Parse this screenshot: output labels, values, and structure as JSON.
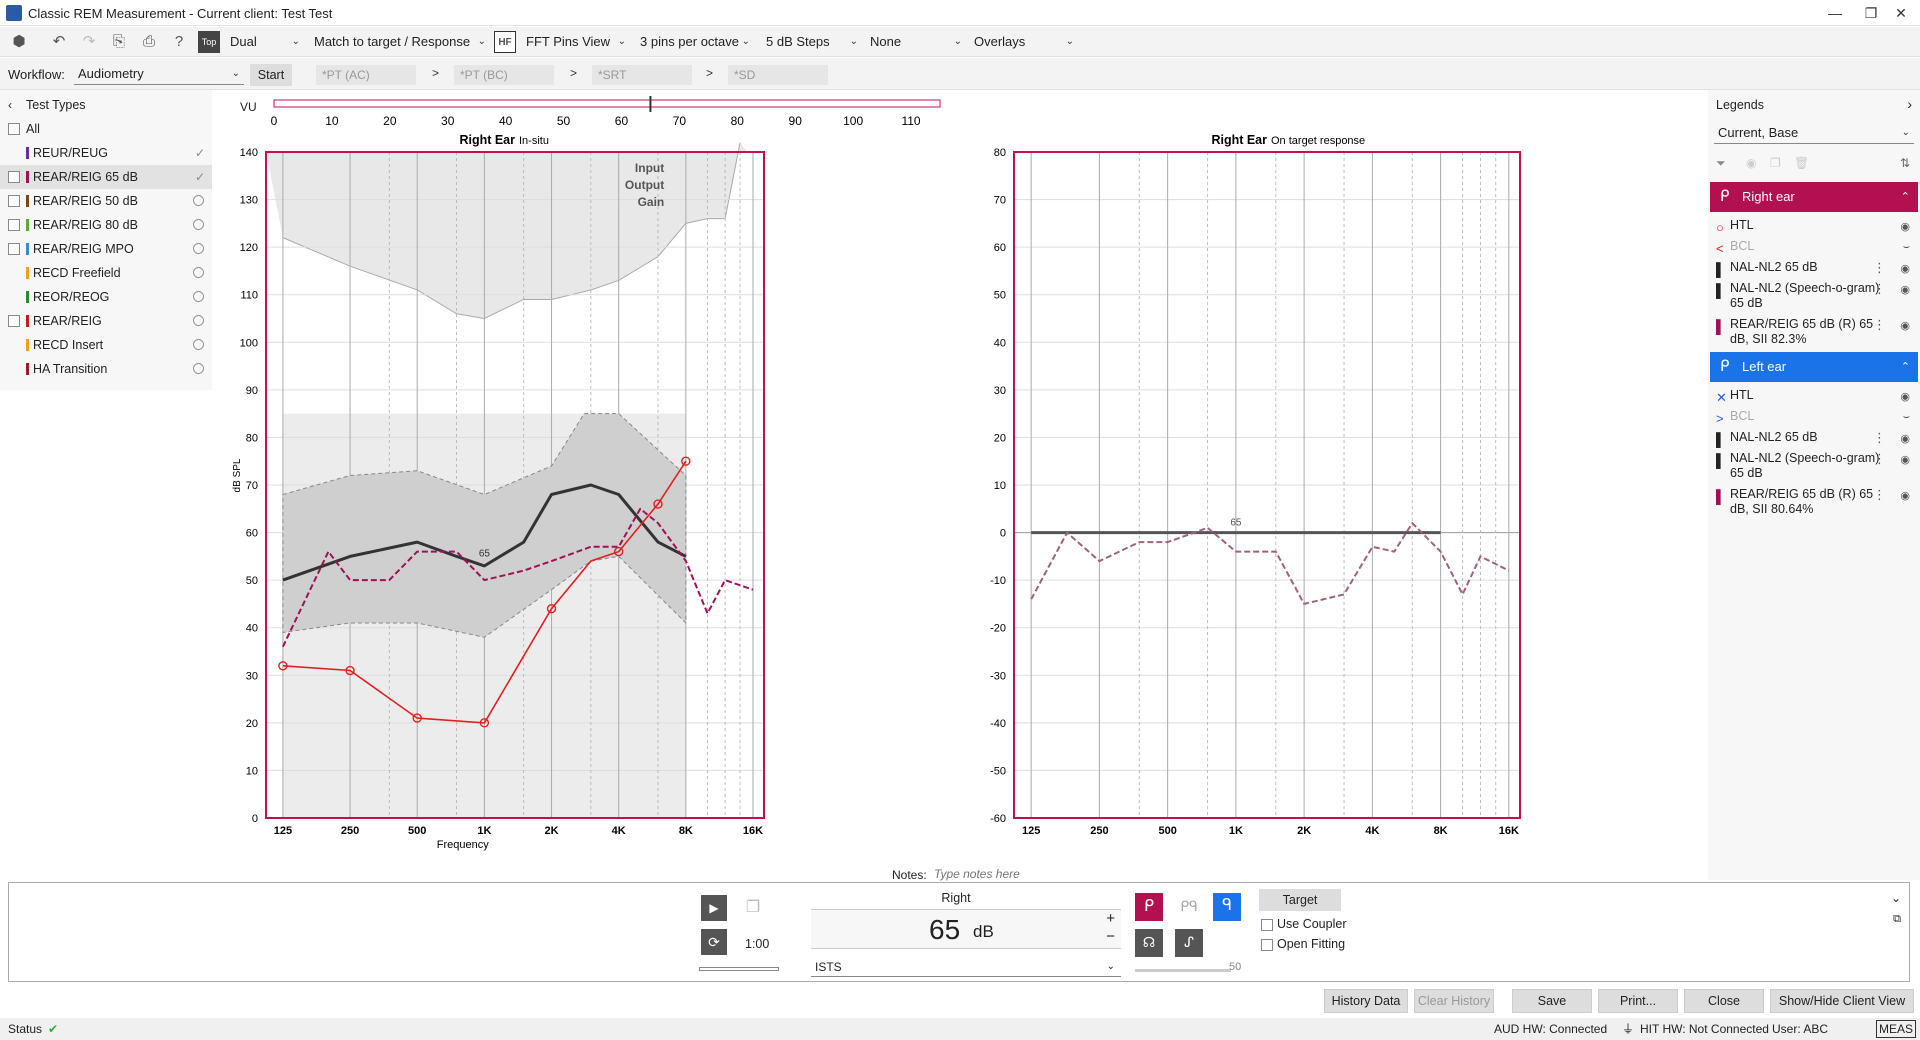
{
  "window": {
    "title": "Classic REM Measurement - Current client: Test Test",
    "min": "—",
    "restore": "❐",
    "close": "✕"
  },
  "toolbar": {
    "dropdowns": [
      "Dual",
      "Match to target / Response",
      "FFT Pins View",
      "3 pins per octave",
      "5 dB Steps",
      "None",
      "Overlays"
    ],
    "hf_label": "HF",
    "top_label": "Top"
  },
  "workflow": {
    "label": "Workflow:",
    "value": "Audiometry",
    "start": "Start",
    "steps": [
      "*PT (AC)",
      "*PT (BC)",
      "*SRT",
      "*SD"
    ]
  },
  "test_types": {
    "header": "Test Types",
    "all_label": "All",
    "items": [
      {
        "label": "REUR/REUG",
        "color": "#6a2aa0",
        "checkbox": false,
        "state": "check",
        "selected": false
      },
      {
        "label": "REAR/REIG 65 dB",
        "color": "#a0105a",
        "checkbox": true,
        "state": "check",
        "selected": true
      },
      {
        "label": "REAR/REIG 50 dB",
        "color": "#7a4a1a",
        "checkbox": true,
        "state": "circle",
        "selected": false
      },
      {
        "label": "REAR/REIG 80 dB",
        "color": "#5aaa30",
        "checkbox": true,
        "state": "circle",
        "selected": false
      },
      {
        "label": "REAR/REIG MPO",
        "color": "#3a8ad8",
        "checkbox": true,
        "state": "circle",
        "selected": false
      },
      {
        "label": "RECD Freefield",
        "color": "#f0a020",
        "checkbox": false,
        "state": "circle",
        "selected": false
      },
      {
        "label": "REOR/REOG",
        "color": "#2a8a3a",
        "checkbox": false,
        "state": "circle",
        "selected": false
      },
      {
        "label": "REAR/REIG",
        "color": "#c01a1a",
        "checkbox": true,
        "state": "circle",
        "selected": false
      },
      {
        "label": "RECD Insert",
        "color": "#f0a020",
        "checkbox": false,
        "state": "circle",
        "selected": false
      },
      {
        "label": "HA Transition",
        "color": "#a01a1a",
        "checkbox": false,
        "state": "circle",
        "selected": false
      }
    ]
  },
  "vu": {
    "label": "VU",
    "ticks": [
      "0",
      "10",
      "20",
      "30",
      "40",
      "50",
      "60",
      "70",
      "80",
      "90",
      "100",
      "110"
    ],
    "level": 65
  },
  "chart_data": [
    {
      "type": "line",
      "title": "Right Ear",
      "subtitle": "In-situ",
      "xlabel": "Frequency",
      "ylabel": "dB SPL",
      "x_ticks": [
        "125",
        "250",
        "500",
        "1K",
        "2K",
        "4K",
        "8K",
        "16K"
      ],
      "ylim": [
        0,
        140
      ],
      "y_ticks": [
        "0",
        "10",
        "20",
        "30",
        "40",
        "50",
        "60",
        "70",
        "80",
        "90",
        "100",
        "110",
        "120",
        "130",
        "140"
      ],
      "corner_labels": [
        "Input",
        "Output",
        "Gain"
      ],
      "annotation": "65",
      "series": [
        {
          "key": "htl",
          "freq": [
            125,
            250,
            500,
            1000,
            2000,
            3000,
            4000,
            6000,
            8000
          ],
          "values": [
            32,
            31,
            21,
            20,
            44,
            54,
            56,
            66,
            75
          ],
          "color": "#e02020"
        },
        {
          "key": "nal",
          "freq": [
            125,
            250,
            500,
            750,
            1000,
            1500,
            2000,
            3000,
            4000,
            6000,
            8000
          ],
          "values": [
            50,
            55,
            58,
            55,
            53,
            58,
            68,
            70,
            68,
            58,
            55
          ],
          "color": "#333333"
        },
        {
          "key": "rear",
          "freq": [
            125,
            200,
            250,
            375,
            500,
            750,
            1000,
            1500,
            2000,
            3000,
            4000,
            5000,
            6000,
            8000,
            10000,
            12000,
            16000
          ],
          "values": [
            36,
            56,
            50,
            50,
            56,
            56,
            50,
            52,
            54,
            57,
            57,
            65,
            62,
            54,
            43,
            50,
            48
          ],
          "color": "#a0105a"
        },
        {
          "key": "band_upper",
          "freq": [
            125,
            250,
            500,
            1000,
            2000,
            2800,
            4000,
            8000
          ],
          "values": [
            68,
            72,
            73,
            68,
            74,
            85,
            85,
            72
          ]
        },
        {
          "key": "band_lower",
          "freq": [
            125,
            250,
            500,
            1000,
            2000,
            3000,
            4000,
            8000
          ],
          "values": [
            39,
            41,
            41,
            38,
            48,
            54,
            55,
            41
          ]
        },
        {
          "key": "ucl",
          "freq": [
            125,
            250,
            500,
            750,
            1000,
            1500,
            2000,
            3000,
            4000,
            6000,
            8000,
            10000,
            12000,
            14000
          ],
          "values": [
            122,
            116,
            111,
            106,
            105,
            109,
            109,
            111,
            113,
            118,
            125,
            126,
            126,
            142
          ],
          "color": "#999999"
        }
      ]
    },
    {
      "type": "line",
      "title": "Right Ear",
      "subtitle": "On target response",
      "x_ticks": [
        "125",
        "250",
        "500",
        "1K",
        "2K",
        "4K",
        "8K",
        "16K"
      ],
      "ylim": [
        -60,
        80
      ],
      "y_ticks": [
        "-60",
        "-50",
        "-40",
        "-30",
        "-20",
        "-10",
        "0",
        "10",
        "20",
        "30",
        "40",
        "50",
        "60",
        "70",
        "80"
      ],
      "annotation": "65",
      "series": [
        {
          "key": "target",
          "freq": [
            125,
            8000
          ],
          "values": [
            0,
            0
          ],
          "color": "#555555"
        },
        {
          "key": "response",
          "freq": [
            125,
            180,
            250,
            375,
            500,
            750,
            1000,
            1500,
            2000,
            3000,
            4000,
            5000,
            6000,
            8000,
            10000,
            12000,
            16000
          ],
          "values": [
            -14,
            0,
            -6,
            -2,
            -2,
            1,
            -4,
            -4,
            -15,
            -13,
            -3,
            -4,
            2,
            -4,
            -13,
            -5,
            -8
          ],
          "color": "#a06080"
        }
      ]
    }
  ],
  "legends": {
    "header": "Legends",
    "select": "Current, Base",
    "right_ear": {
      "header": "Right ear",
      "items": [
        {
          "symbol": "○",
          "sym_color": "#e02020",
          "label": "HTL",
          "muted": false,
          "dots": false
        },
        {
          "symbol": "<",
          "sym_color": "#e02020",
          "label": "BCL",
          "muted": true,
          "dots": false
        },
        {
          "symbol": "▌",
          "sym_color": "#222222",
          "label": "NAL-NL2 65 dB",
          "muted": false,
          "dots": true
        },
        {
          "symbol": "▌",
          "sym_color": "#222222",
          "label": "NAL-NL2 (Speech-o-gram) 65 dB",
          "muted": false,
          "dots": true
        },
        {
          "symbol": "▌",
          "sym_color": "#a0105a",
          "label": "REAR/REIG 65 dB (R) 65 dB, SII 82.3%",
          "muted": false,
          "dots": true
        }
      ]
    },
    "left_ear": {
      "header": "Left ear",
      "items": [
        {
          "symbol": "✕",
          "sym_color": "#2a5ad8",
          "label": "HTL",
          "muted": false,
          "dots": false
        },
        {
          "symbol": ">",
          "sym_color": "#2a5ad8",
          "label": "BCL",
          "muted": true,
          "dots": false
        },
        {
          "symbol": "▌",
          "sym_color": "#222222",
          "label": "NAL-NL2 65 dB",
          "muted": false,
          "dots": true
        },
        {
          "symbol": "▌",
          "sym_color": "#222222",
          "label": "NAL-NL2 (Speech-o-gram) 65 dB",
          "muted": false,
          "dots": true
        },
        {
          "symbol": "▌",
          "sym_color": "#a0105a",
          "label": "REAR/REIG 65 dB (R) 65 dB, SII 80.64%",
          "muted": false,
          "dots": true
        }
      ]
    }
  },
  "notes": {
    "label": "Notes:",
    "placeholder": "Type notes here"
  },
  "stimulus": {
    "side": "Right",
    "level": "65",
    "unit": "dB",
    "plus": "+",
    "minus": "−",
    "signal": "ISTS",
    "time": "1:00",
    "target_label": "Target",
    "use_coupler": "Use Coupler",
    "open_fitting": "Open Fitting",
    "slider_value": "50"
  },
  "buttons": [
    "History Data",
    "Clear History",
    "Save",
    "Print...",
    "Close",
    "Show/Hide Client View"
  ],
  "status": {
    "label": "Status",
    "aud_hw": "AUD HW: Connected",
    "hit_hw": "HIT HW: Not Connected",
    "user": "User: ABC",
    "mode": "MEAS"
  },
  "colors": {
    "accent_right": "#b3104f",
    "accent_left": "#1a73e8",
    "chart_border": "#c0104f"
  }
}
